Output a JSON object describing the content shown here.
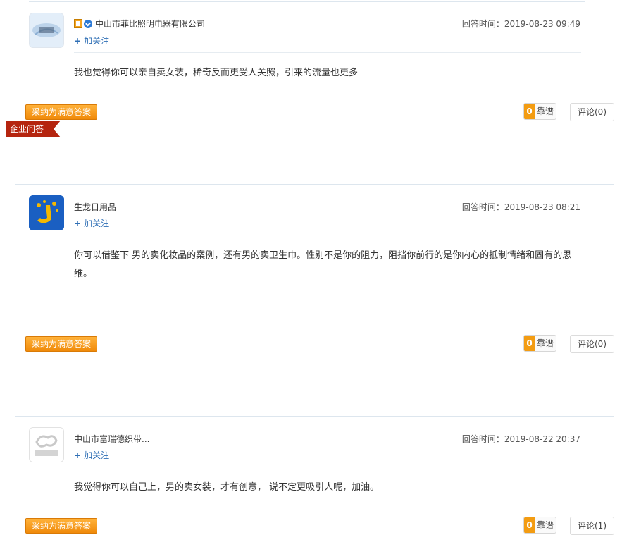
{
  "follow_label": "加关注",
  "adopt_label": "采纳为满意答案",
  "tag_label": "企业问答",
  "answers": [
    {
      "user": "中山市菲比照明电器有限公司",
      "time": "回答时间：2019-08-23 09:49",
      "content": "我也觉得你可以亲自卖女装，稀奇反而更受人关照，引来的流量也更多",
      "kaopu_count": "0",
      "kaopu_label": "靠谱",
      "comment_label": "评论(0)",
      "avatar_icon": "company-logo-icon"
    },
    {
      "user": "生龙日用品",
      "time": "回答时间：2019-08-23 08:21",
      "content": "你可以借鉴下 男的卖化妆品的案例，还有男的卖卫生巾。性别不是你的阻力，阻挡你前行的是你内心的抵制情绪和固有的思维。",
      "kaopu_count": "0",
      "kaopu_label": "靠谱",
      "comment_label": "评论(0)",
      "avatar_icon": "company-logo-icon"
    },
    {
      "user": "中山市富瑞德织带...",
      "time": "回答时间：2019-08-22 20:37",
      "content": "我觉得你可以自己上，男的卖女装，才有创意， 说不定更吸引人呢，加油。",
      "kaopu_count": "0",
      "kaopu_label": "靠谱",
      "comment_label": "评论(1)",
      "avatar_icon": "alibaba-logo-icon"
    }
  ]
}
